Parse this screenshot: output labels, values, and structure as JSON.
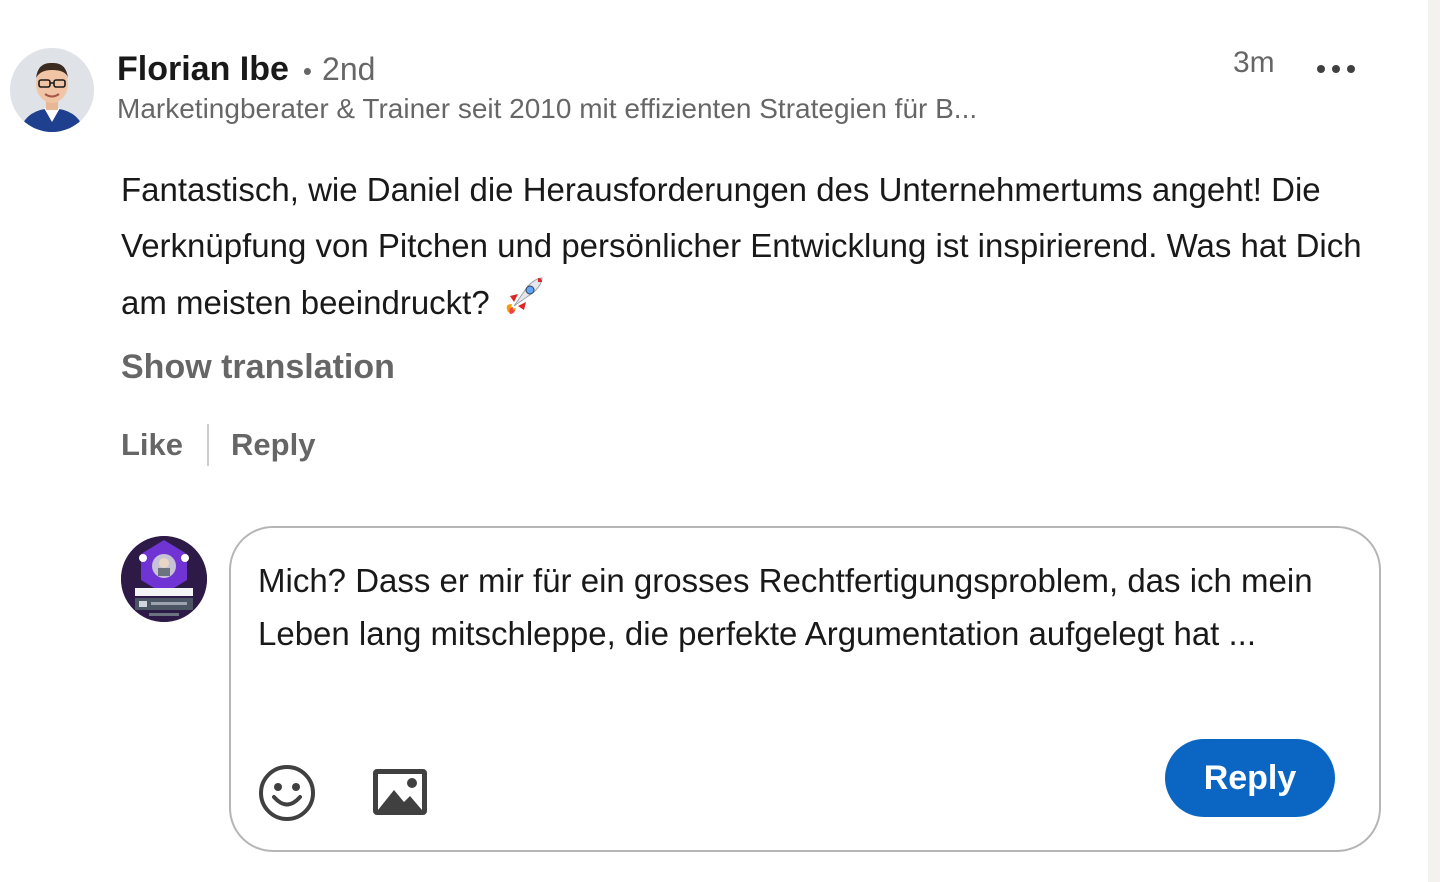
{
  "comment": {
    "author": {
      "name": "Florian Ibe",
      "degree_separator": "•",
      "degree": "2nd",
      "headline": "Marketingberater & Trainer seit 2010 mit effizienten Strategien für B..."
    },
    "timestamp": "3m",
    "more_icon": "more-horizontal-icon",
    "text": "Fantastisch, wie Daniel die Herausforderungen des Unternehmertums angeht! Die Verknüpfung von Pitchen und persönlicher Entwicklung ist inspirierend. Was hat Dich am meisten beeindruckt?",
    "emoji_icon": "rocket-icon",
    "show_translation_label": "Show translation",
    "actions": {
      "like_label": "Like",
      "reply_label": "Reply"
    }
  },
  "reply_composer": {
    "value": "Mich? Dass er mir für ein grosses Rechtfertigungsproblem, das ich mein Leben lang mitschleppe, die perfekte Argumentation aufgelegt hat ...",
    "emoji_icon": "smiley-icon",
    "image_icon": "image-icon",
    "submit_label": "Reply"
  },
  "colors": {
    "primary": "#0a66c2",
    "text_primary": "rgba(0,0,0,0.9)",
    "text_secondary": "rgba(0,0,0,0.6)",
    "border": "#b5b5b5"
  }
}
